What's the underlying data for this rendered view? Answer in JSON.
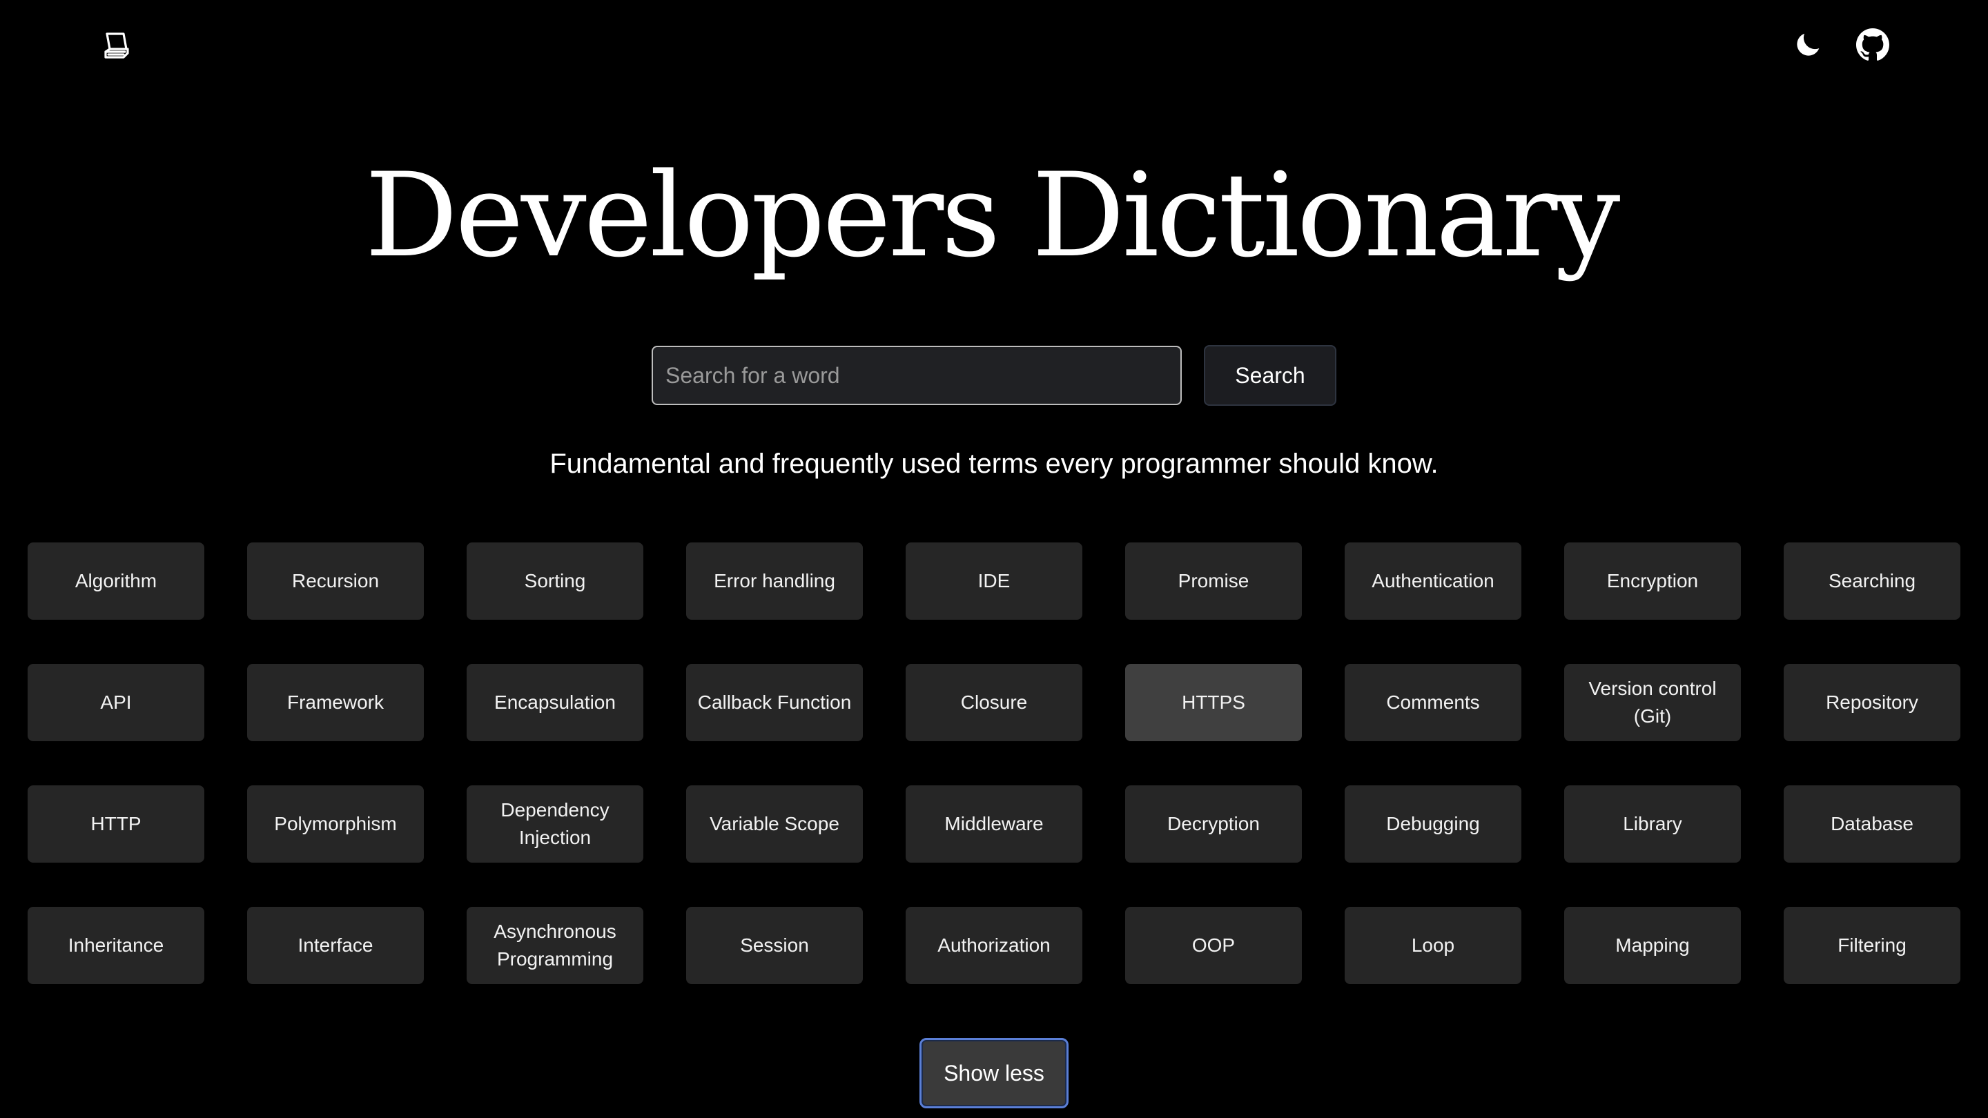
{
  "header": {
    "logo_icon": "book-icon",
    "theme_toggle_icon": "moon-icon",
    "github_icon": "github-icon"
  },
  "hero": {
    "title": "Developers Dictionary",
    "subtitle": "Fundamental and frequently used terms every programmer should know."
  },
  "search": {
    "placeholder": "Search for a word",
    "value": "",
    "button_label": "Search"
  },
  "terms": [
    "Algorithm",
    "Recursion",
    "Sorting",
    "Error handling",
    "IDE",
    "Promise",
    "Authentication",
    "Encryption",
    "Searching",
    "API",
    "Framework",
    "Encapsulation",
    "Callback Function",
    "Closure",
    "HTTPS",
    "Comments",
    "Version control (Git)",
    "Repository",
    "HTTP",
    "Polymorphism",
    "Dependency Injection",
    "Variable Scope",
    "Middleware",
    "Decryption",
    "Debugging",
    "Library",
    "Database",
    "Inheritance",
    "Interface",
    "Asynchronous Programming",
    "Session",
    "Authorization",
    "OOP",
    "Loop",
    "Mapping",
    "Filtering"
  ],
  "hovered_term": "HTTPS",
  "show_toggle": {
    "label": "Show less"
  },
  "colors": {
    "background": "#000000",
    "card": "#262626",
    "card_hover": "#404040",
    "focus_ring": "#5b7fd6"
  }
}
